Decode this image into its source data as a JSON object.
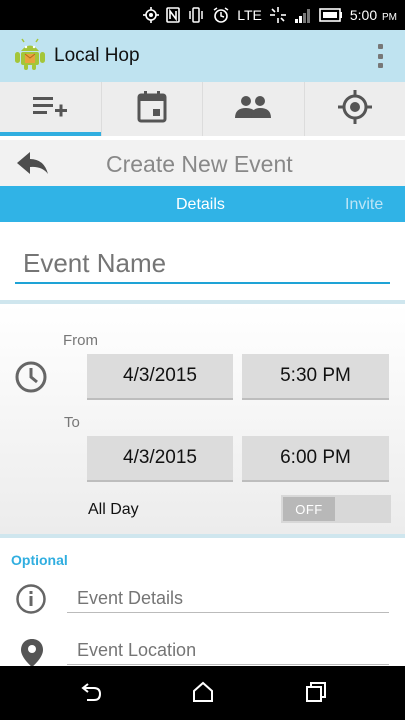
{
  "status_bar": {
    "network": "LTE",
    "time": "5:00",
    "ampm": "PM"
  },
  "app": {
    "title": "Local Hop"
  },
  "tabs": [
    {
      "icon": "add-list-icon",
      "active": true
    },
    {
      "icon": "calendar-icon",
      "active": false
    },
    {
      "icon": "people-icon",
      "active": false
    },
    {
      "icon": "location-target-icon",
      "active": false
    }
  ],
  "header": {
    "title": "Create New Event"
  },
  "subtabs": {
    "details": "Details",
    "invite": "Invite"
  },
  "event_name": {
    "placeholder": "Event Name",
    "value": ""
  },
  "time": {
    "from_label": "From",
    "to_label": "To",
    "from_date": "4/3/2015",
    "from_time": "5:30 PM",
    "to_date": "4/3/2015",
    "to_time": "6:00 PM",
    "all_day_label": "All Day",
    "all_day_toggle": "OFF"
  },
  "optional": {
    "label": "Optional",
    "details_placeholder": "Event Details",
    "location_placeholder": "Event Location"
  },
  "colors": {
    "accent": "#30b3e6",
    "action_bar": "#bfe3f0"
  }
}
